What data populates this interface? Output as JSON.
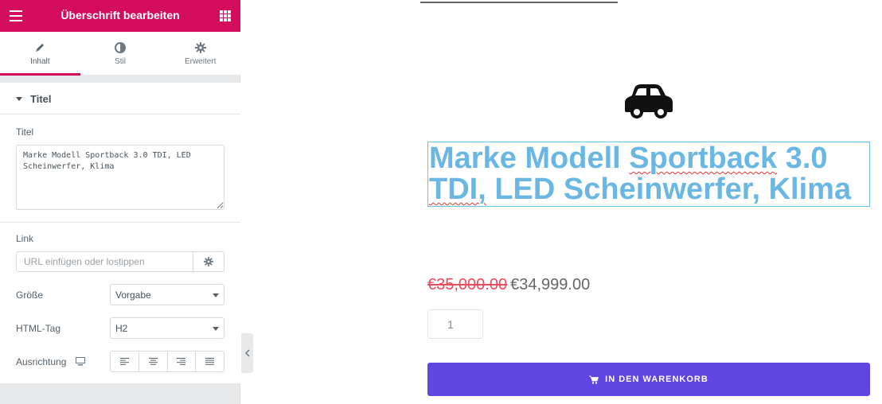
{
  "panel": {
    "header": {
      "title": "Überschrift bearbeiten"
    },
    "tabs": [
      {
        "label": "Inhalt",
        "icon": "pencil-icon"
      },
      {
        "label": "Stil",
        "icon": "contrast-icon"
      },
      {
        "label": "Erweitert",
        "icon": "gear-icon"
      }
    ],
    "section": {
      "title": "Titel",
      "title_label": "Titel",
      "title_value": "Marke Modell Sportback 3.0 TDI, LED Scheinwerfer, Klima",
      "link_label": "Link",
      "link_placeholder": "URL einfügen oder lostippen",
      "size_label": "Größe",
      "size_value": "Vorgabe",
      "tag_label": "HTML-Tag",
      "tag_value": "H2",
      "align_label": "Ausrichtung"
    }
  },
  "preview": {
    "icon": "car-icon",
    "headline_words": [
      "Marke",
      "Modell",
      "Sportback",
      "3.0",
      "TDI,",
      "LED",
      "Scheinwerfer,",
      "Klima"
    ],
    "price_old": "€35,000.00",
    "price_new": "€34,999.00",
    "quantity": "1",
    "cart_label": "IN DEN WARENKORB"
  },
  "colors": {
    "brand": "#d30c5c",
    "headline": "#6ab7e3",
    "button": "#5f45e2",
    "sale": "#e84b5c"
  }
}
